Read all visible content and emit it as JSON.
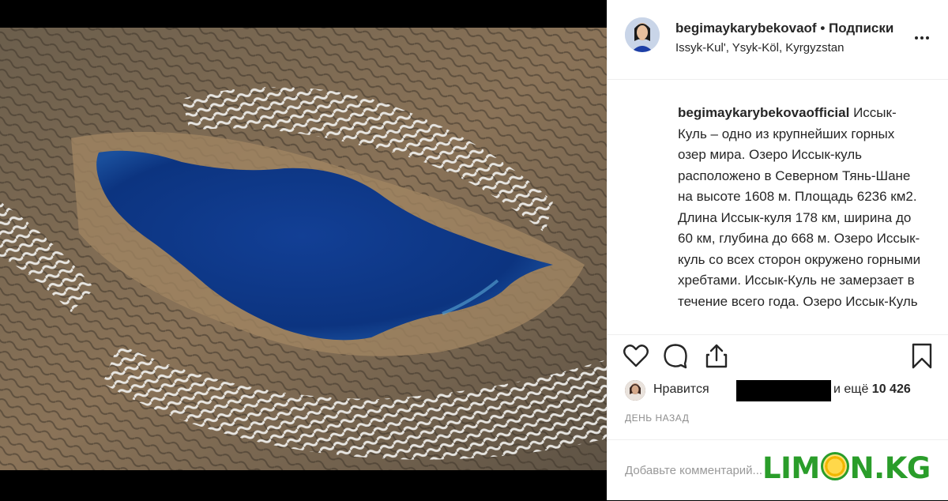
{
  "post": {
    "username": "begimaykarybekovaof",
    "separator": "•",
    "follow_label": "Подписки",
    "location": "Issyk-Kul', Ysyk-Köl, Kyrgyzstan",
    "caption_username": "begimaykarybekovaofficial",
    "caption_text": "Иссык-Куль – одно из крупнейших горных озер мира. Озеро Иссык-куль расположено в Северном Тянь-Шане на высоте 1608 м. Площадь 6236 км2. Длина Иссык-куля 178 км, ширина до 60 км, глубина до 668 м. Озеро Иссык-куль со всех сторон окружено горными хребтами. Иссык-Куль не замерзает в течение всего года. Озеро Иссык-Куль",
    "likes_prefix": "Нравится",
    "likes_suffix_pre": "и ещё",
    "likes_count": "10 426",
    "timestamp": "ДЕНЬ НАЗАД",
    "comment_placeholder": "Добавьте комментарий..."
  },
  "icons": {
    "more": "more-dots-icon",
    "like": "heart-icon",
    "comment": "comment-bubble-icon",
    "share": "share-icon",
    "save": "bookmark-icon"
  },
  "watermark": {
    "text_before": "LIM",
    "text_after": "N.KG"
  },
  "colors": {
    "text": "#262626",
    "muted": "#8e8e8e",
    "border": "#efefef",
    "watermark": "#2a9d2a",
    "lake": "#0d3d8f"
  }
}
